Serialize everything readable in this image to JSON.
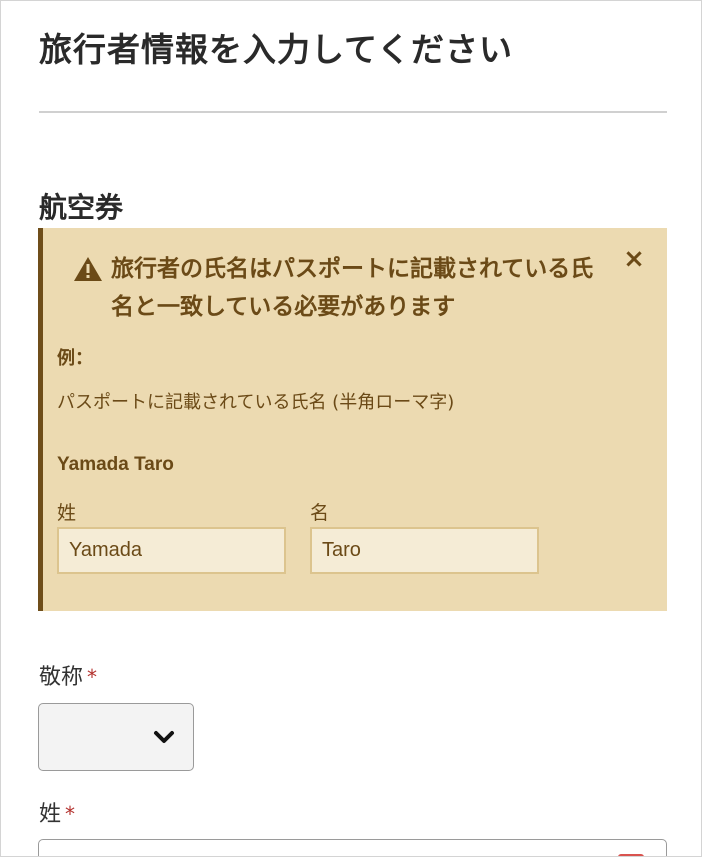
{
  "page": {
    "title": "旅行者情報を入力してください"
  },
  "section": {
    "title": "航空券"
  },
  "notice": {
    "icon": "warning-icon",
    "heading": "旅行者の氏名はパスポートに記載されている氏名と一致している必要があります",
    "close_symbol": "×",
    "example_label": "例：",
    "example_description": "パスポートに記載されている氏名 (半角ローマ字)",
    "example_name": "Yamada Taro",
    "surname_label": "姓",
    "surname_value": "Yamada",
    "given_name_label": "名",
    "given_name_value": "Taro",
    "background_color": "#ecdab1",
    "accent_color": "#6f4e1a"
  },
  "form": {
    "title_field": {
      "label": "敬称",
      "required_mark": "*",
      "selected_value": ""
    },
    "surname_field": {
      "label": "姓",
      "required_mark": "*",
      "value": ""
    },
    "required_color": "#b3312d"
  }
}
